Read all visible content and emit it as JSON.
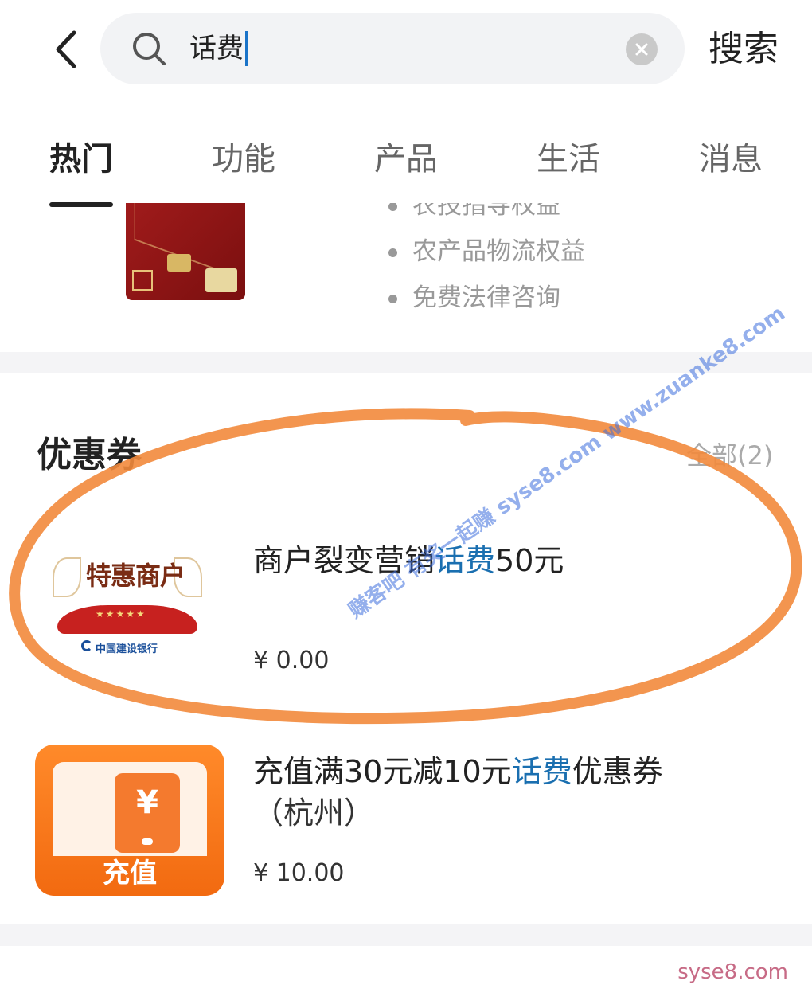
{
  "search": {
    "query": "话费",
    "submit_label": "搜索"
  },
  "tabs": [
    {
      "label": "热门",
      "active": true
    },
    {
      "label": "功能",
      "active": false
    },
    {
      "label": "产品",
      "active": false
    },
    {
      "label": "生活",
      "active": false
    },
    {
      "label": "消息",
      "active": false
    }
  ],
  "product": {
    "benefits": [
      "农技指导权益",
      "农产品物流权益",
      "免费法律咨询"
    ]
  },
  "coupons": {
    "title": "优惠券",
    "see_all": "全部(2)",
    "items": [
      {
        "title_pre": "商户裂变营销",
        "title_hl": "话费",
        "title_post": "50元",
        "price": "¥ 0.00",
        "image_text": "特惠商户",
        "image_bank": "中国建设银行"
      },
      {
        "title_pre": "充值满30元减10元",
        "title_hl": "话费",
        "title_post": "优惠券",
        "title_line2": "（杭州）",
        "price": "¥ 10.00",
        "image_label": "充值",
        "image_symbol": "¥"
      }
    ]
  },
  "watermarks": {
    "corner": "syse8.com",
    "diagonal": "赚客吧 有奖一起赚 syse8.com www.zuanke8.com"
  },
  "colors": {
    "highlight": "#1a6fb0",
    "annotation": "#f28a3c",
    "recharge_orange": "#f26a10"
  },
  "icons": [
    "back-icon",
    "search-icon",
    "clear-icon"
  ]
}
